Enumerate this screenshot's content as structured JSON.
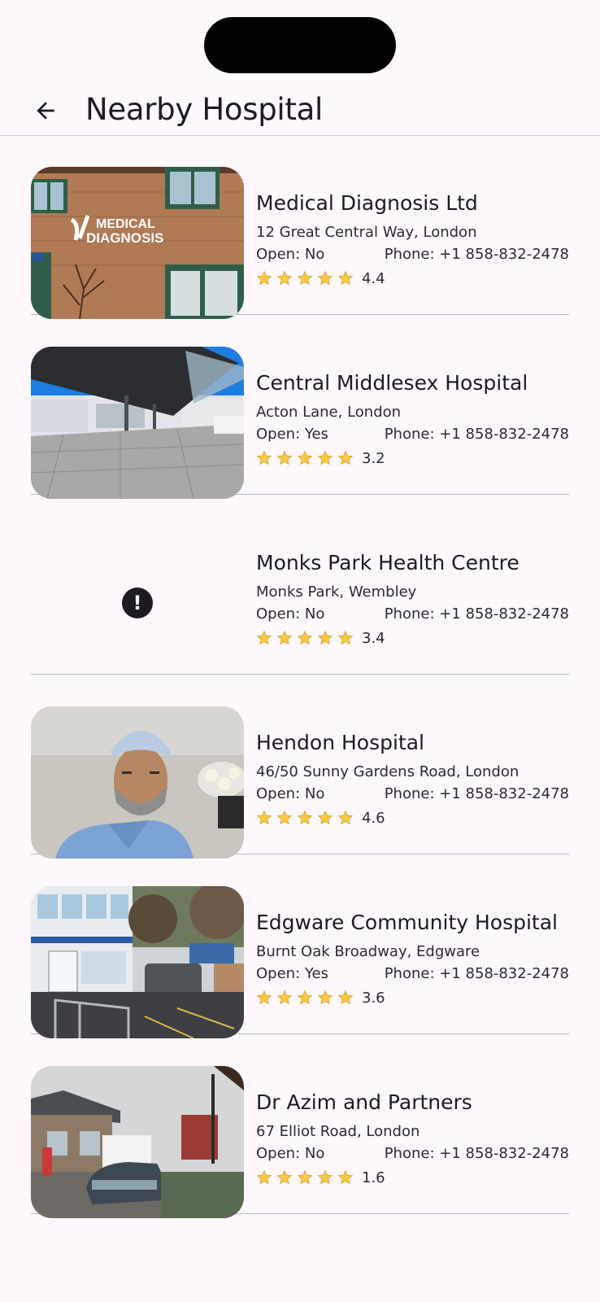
{
  "header": {
    "title": "Nearby Hospital"
  },
  "hospitals": [
    {
      "name": "Medical Diagnosis Ltd",
      "address": "12 Great Central Way, London",
      "open": "Open: No",
      "phone": "Phone: +1 858-832-2478",
      "rating": "4.4",
      "image": "photo",
      "image_sign": [
        "MEDICAL",
        "DIAGNOSIS"
      ]
    },
    {
      "name": "Central Middlesex Hospital",
      "address": "Acton Lane, London",
      "open": "Open: Yes",
      "phone": "Phone: +1 858-832-2478",
      "rating": "3.2",
      "image": "photo"
    },
    {
      "name": "Monks Park Health Centre",
      "address": "Monks Park, Wembley",
      "open": "Open: No",
      "phone": "Phone: +1 858-832-2478",
      "rating": "3.4",
      "image": "error-icon"
    },
    {
      "name": "Hendon Hospital",
      "address": "46/50 Sunny Gardens Road, London",
      "open": "Open: No",
      "phone": "Phone: +1 858-832-2478",
      "rating": "4.6",
      "image": "photo"
    },
    {
      "name": "Edgware Community Hospital",
      "address": "Burnt Oak Broadway, Edgware",
      "open": "Open: Yes",
      "phone": "Phone: +1 858-832-2478",
      "rating": "3.6",
      "image": "photo"
    },
    {
      "name": "Dr Azim and Partners",
      "address": "67 Elliot Road, London",
      "open": "Open: No",
      "phone": "Phone: +1 858-832-2478",
      "rating": "1.6",
      "image": "photo"
    }
  ],
  "icons": {
    "back": "arrow-left-icon",
    "star": "star-icon",
    "error": "error-icon"
  },
  "colors": {
    "background": "#fef7fc",
    "star": "#f7c948"
  }
}
